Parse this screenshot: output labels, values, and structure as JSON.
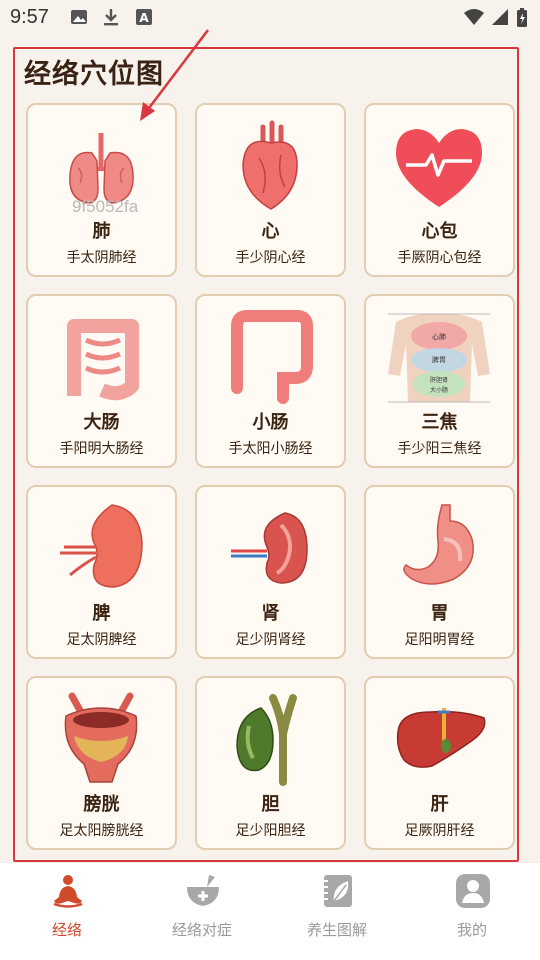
{
  "status_bar": {
    "time": "9:57"
  },
  "page": {
    "title": "经络穴位图"
  },
  "watermark": "9f5052fa",
  "cards": [
    {
      "name": "肺",
      "meridian": "手太阴肺经",
      "icon": "lungs-icon"
    },
    {
      "name": "心",
      "meridian": "手少阴心经",
      "icon": "heart-organ-icon"
    },
    {
      "name": "心包",
      "meridian": "手厥阴心包经",
      "icon": "pericardium-heart-icon"
    },
    {
      "name": "大肠",
      "meridian": "手阳明大肠经",
      "icon": "large-intestine-icon"
    },
    {
      "name": "小肠",
      "meridian": "手太阳小肠经",
      "icon": "small-intestine-icon"
    },
    {
      "name": "三焦",
      "meridian": "手少阳三焦经",
      "icon": "torso-sanjiao-icon"
    },
    {
      "name": "脾",
      "meridian": "足太阴脾经",
      "icon": "spleen-icon"
    },
    {
      "name": "肾",
      "meridian": "足少阴肾经",
      "icon": "kidney-icon"
    },
    {
      "name": "胃",
      "meridian": "足阳明胃经",
      "icon": "stomach-icon"
    },
    {
      "name": "膀胱",
      "meridian": "足太阳膀胱经",
      "icon": "bladder-icon"
    },
    {
      "name": "胆",
      "meridian": "足少阳胆经",
      "icon": "gallbladder-icon"
    },
    {
      "name": "肝",
      "meridian": "足厥阴肝经",
      "icon": "liver-icon"
    }
  ],
  "torso_labels": [
    "心肺",
    "脾胃",
    "肝胆肾",
    "大小肠"
  ],
  "nav": [
    {
      "label": "经络",
      "icon": "meditation-icon",
      "active": true
    },
    {
      "label": "经络对症",
      "icon": "mortar-icon",
      "active": false
    },
    {
      "label": "养生图解",
      "icon": "notebook-leaf-icon",
      "active": false
    },
    {
      "label": "我的",
      "icon": "user-icon",
      "active": false
    }
  ],
  "colors": {
    "accent": "#d14a2c",
    "card_border": "#e2cdb1",
    "annotation_red": "#d9363e"
  }
}
